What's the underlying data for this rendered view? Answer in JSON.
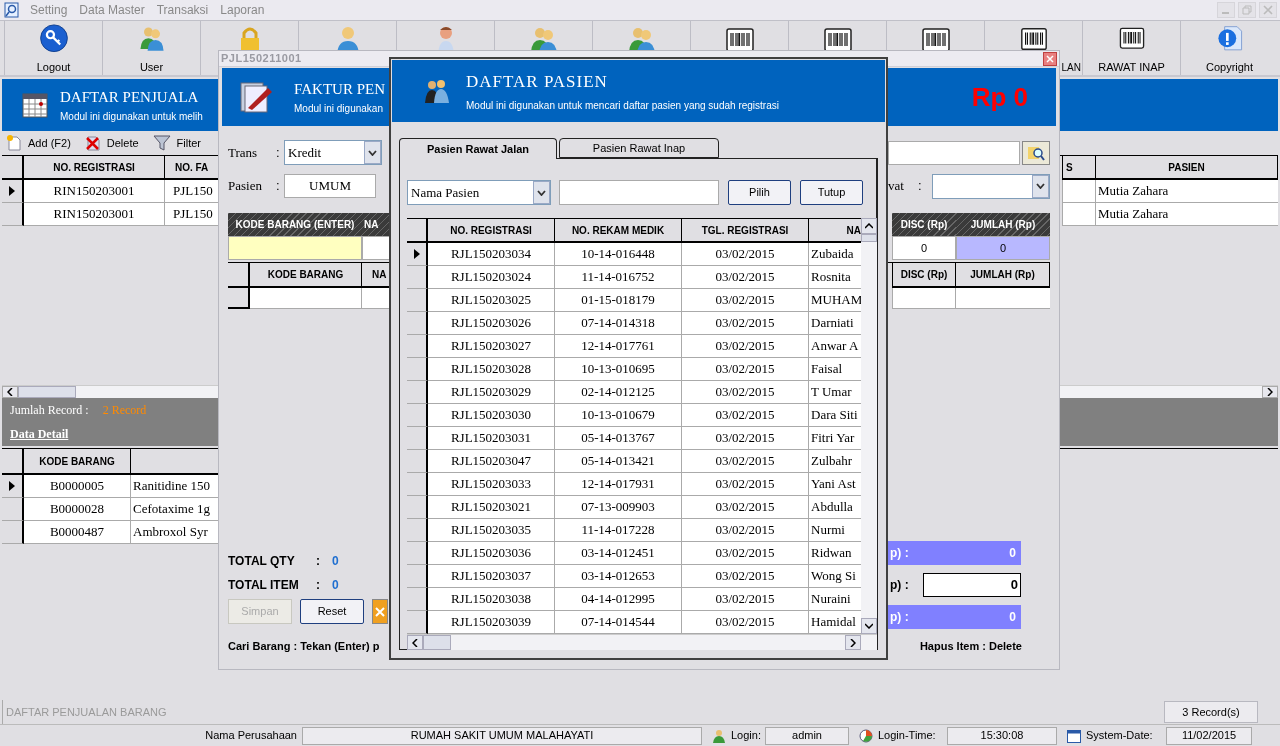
{
  "menu": [
    "Setting",
    "Data Master",
    "Transaksi",
    "Laporan"
  ],
  "toolbar": [
    {
      "kind": "key",
      "label": "Logout"
    },
    {
      "kind": "users",
      "label": "User"
    },
    {
      "kind": "lock"
    },
    {
      "kind": "user"
    },
    {
      "kind": "nurse"
    },
    {
      "kind": "users"
    },
    {
      "kind": "users"
    },
    {
      "kind": "barcode"
    },
    {
      "kind": "barcode"
    },
    {
      "kind": "barcode"
    },
    {
      "kind": "barcode",
      "label": "LAN",
      "clipped_left": true
    },
    {
      "kind": "barcode",
      "label": "RAWAT INAP"
    },
    {
      "kind": "info",
      "label": "Copyright"
    }
  ],
  "main": {
    "title": "DAFTAR PENJUALA",
    "subtitle": "Modul ini digunakan untuk melih",
    "actions": [
      {
        "kind": "add",
        "label": "Add (F2)"
      },
      {
        "kind": "delete",
        "label": "Delete"
      },
      {
        "kind": "filter",
        "label": "Filter"
      }
    ],
    "columns": {
      "no_registrasi": "NO. REGISTRASI",
      "no_fa": "NO. FA",
      "column_3": "S",
      "pasien": "PASIEN"
    },
    "rows": [
      {
        "selected": true,
        "no_registrasi": "RIN150203001",
        "no_fa": "PJL150",
        "pasien": "Mutia Zahara"
      },
      {
        "selected": false,
        "no_registrasi": "RIN150203001",
        "no_fa": "PJL150",
        "pasien": "Mutia Zahara"
      }
    ],
    "record_label": "Jumlah Record :",
    "record_value": "2 Record",
    "detail_link": "Data Detail",
    "detail_columns": [
      "KODE BARANG"
    ],
    "detail_rows": [
      {
        "selected": true,
        "kode": "B0000005",
        "nama": "Ranitidine 150"
      },
      {
        "selected": false,
        "kode": "B0000028",
        "nama": "Cefotaxime 1g"
      },
      {
        "selected": false,
        "kode": "B0000487",
        "nama": "Ambroxol Syr"
      }
    ],
    "caption": "DAFTAR PENJUALAN BARANG",
    "record_button": "3 Record(s)"
  },
  "status_bar": {
    "company_label": "Nama Perusahaan",
    "company": "RUMAH SAKIT UMUM MALAHAYATI",
    "login_label": "Login:",
    "login": "admin",
    "login_time_label": "Login-Time:",
    "login_time": "15:30:08",
    "date_label": "System-Date:",
    "date": "11/02/2015"
  },
  "faktur": {
    "title": "PJL150211001",
    "heading": "FAKTUR PEN",
    "subtitle": "Modul ini digunakan",
    "total": "Rp 0",
    "trans": {
      "label": "Trans",
      "colon": ":",
      "value": "Kredit"
    },
    "pasien": {
      "label": "Pasien",
      "colon": ":",
      "value": "UMUM"
    },
    "rawat": {
      "label": "vat",
      "colon": ":"
    },
    "entry_header": {
      "kode": "KODE BARANG (ENTER)",
      "nama": "NA",
      "disc": "DISC (Rp)",
      "jumlah": "JUMLAH (Rp)"
    },
    "entry_values": {
      "disc": "0",
      "jumlah": "0"
    },
    "item_header": {
      "kode": "KODE BARANG",
      "nama": "NA",
      "disc": "DISC (Rp)",
      "jumlah": "JUMLAH (Rp)"
    },
    "totals": [
      {
        "label": "TOTAL QTY",
        "colon": ":",
        "value": "0"
      },
      {
        "label": "TOTAL ITEM",
        "colon": ":",
        "value": "0"
      }
    ],
    "buttons": [
      {
        "label": "Simpan",
        "disabled": true
      },
      {
        "label": "Reset",
        "disabled": false
      }
    ],
    "summary": [
      {
        "kind": "bar",
        "label": "p) :",
        "value": "0"
      },
      {
        "kind": "field",
        "label": "p) :",
        "value": "0"
      },
      {
        "kind": "bar",
        "label": "p) :",
        "value": "0"
      }
    ],
    "hint_left": "Cari Barang : Tekan (Enter) p",
    "hint_right": "Hapus Item : Delete"
  },
  "dialog": {
    "title": "DAFTAR PASIEN",
    "subtitle": "Modul ini digunakan untuk mencari daftar pasien yang sudah registrasi",
    "tabs": [
      {
        "label": "Pasien Rawat Jalan",
        "selected": true
      },
      {
        "label": "Pasien Rawat Inap",
        "selected": false
      }
    ],
    "filter": "Nama Pasien",
    "buttons": [
      "Pilih",
      "Tutup"
    ],
    "columns": [
      "NO. REGISTRASI",
      "NO. REKAM MEDIK",
      "TGL. REGISTRASI",
      "NA"
    ],
    "rows": [
      {
        "selected": true,
        "cells": [
          "RJL150203034",
          "10-14-016448",
          "03/02/2015",
          "Zubaida"
        ]
      },
      {
        "selected": false,
        "cells": [
          "RJL150203024",
          "11-14-016752",
          "03/02/2015",
          "Rosnita"
        ]
      },
      {
        "selected": false,
        "cells": [
          "RJL150203025",
          "01-15-018179",
          "03/02/2015",
          "MUHAM"
        ]
      },
      {
        "selected": false,
        "cells": [
          "RJL150203026",
          "07-14-014318",
          "03/02/2015",
          "Darniati"
        ]
      },
      {
        "selected": false,
        "cells": [
          "RJL150203027",
          "12-14-017761",
          "03/02/2015",
          "Anwar A"
        ]
      },
      {
        "selected": false,
        "cells": [
          "RJL150203028",
          "10-13-010695",
          "03/02/2015",
          "Faisal"
        ]
      },
      {
        "selected": false,
        "cells": [
          "RJL150203029",
          "02-14-012125",
          "03/02/2015",
          "T Umar"
        ]
      },
      {
        "selected": false,
        "cells": [
          "RJL150203030",
          "10-13-010679",
          "03/02/2015",
          "Dara Siti"
        ]
      },
      {
        "selected": false,
        "cells": [
          "RJL150203031",
          "05-14-013767",
          "03/02/2015",
          "Fitri Yar"
        ]
      },
      {
        "selected": false,
        "cells": [
          "RJL150203047",
          "05-14-013421",
          "03/02/2015",
          "Zulbahr"
        ]
      },
      {
        "selected": false,
        "cells": [
          "RJL150203033",
          "12-14-017931",
          "03/02/2015",
          "Yani Ast"
        ]
      },
      {
        "selected": false,
        "cells": [
          "RJL150203021",
          "07-13-009903",
          "03/02/2015",
          "Abdulla"
        ]
      },
      {
        "selected": false,
        "cells": [
          "RJL150203035",
          "11-14-017228",
          "03/02/2015",
          "Nurmi"
        ]
      },
      {
        "selected": false,
        "cells": [
          "RJL150203036",
          "03-14-012451",
          "03/02/2015",
          "Ridwan"
        ]
      },
      {
        "selected": false,
        "cells": [
          "RJL150203037",
          "03-14-012653",
          "03/02/2015",
          "Wong Si"
        ]
      },
      {
        "selected": false,
        "cells": [
          "RJL150203038",
          "04-14-012995",
          "03/02/2015",
          "Nuraini"
        ]
      },
      {
        "selected": false,
        "cells": [
          "RJL150203039",
          "07-14-014544",
          "03/02/2015",
          "Hamidal"
        ]
      }
    ]
  }
}
